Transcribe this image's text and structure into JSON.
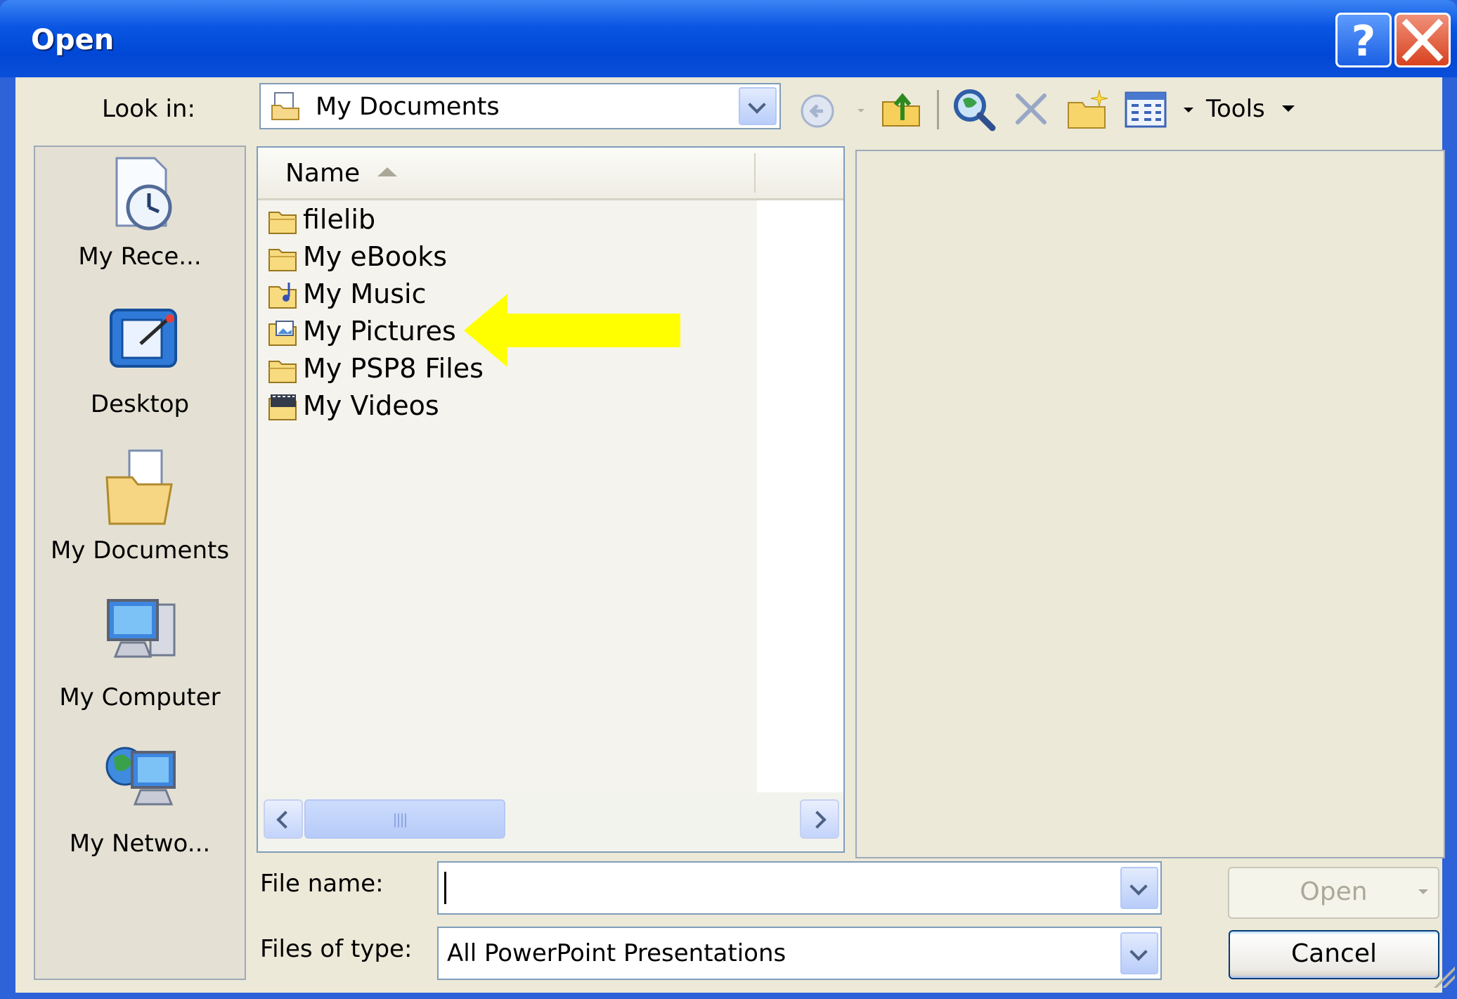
{
  "window": {
    "title": "Open"
  },
  "toolbar": {
    "look_in_label": "Look in:",
    "look_in_value": "My Documents",
    "tools_label": "Tools"
  },
  "places": [
    {
      "label": "My Rece...",
      "icon": "my-recent-documents-icon"
    },
    {
      "label": "Desktop",
      "icon": "desktop-icon"
    },
    {
      "label": "My Documents",
      "icon": "my-documents-icon"
    },
    {
      "label": "My Computer",
      "icon": "my-computer-icon"
    },
    {
      "label": "My Netwo...",
      "icon": "my-network-places-icon"
    }
  ],
  "file_list": {
    "column_name": "Name",
    "items": [
      {
        "name": "filelib",
        "icon": "folder-icon"
      },
      {
        "name": "My eBooks",
        "icon": "folder-icon"
      },
      {
        "name": "My Music",
        "icon": "music-folder-icon"
      },
      {
        "name": "My Pictures",
        "icon": "pictures-folder-icon"
      },
      {
        "name": "My PSP8 Files",
        "icon": "folder-icon"
      },
      {
        "name": "My Videos",
        "icon": "videos-folder-icon"
      }
    ]
  },
  "form": {
    "file_name_label": "File name:",
    "file_name_value": "",
    "files_of_type_label": "Files of type:",
    "files_of_type_value": "All PowerPoint Presentations"
  },
  "buttons": {
    "open": "Open",
    "cancel": "Cancel"
  },
  "colors": {
    "title_bar": "#0a56e3",
    "dialog_bg": "#ece9d8",
    "callout_arrow": "#ffff00"
  }
}
